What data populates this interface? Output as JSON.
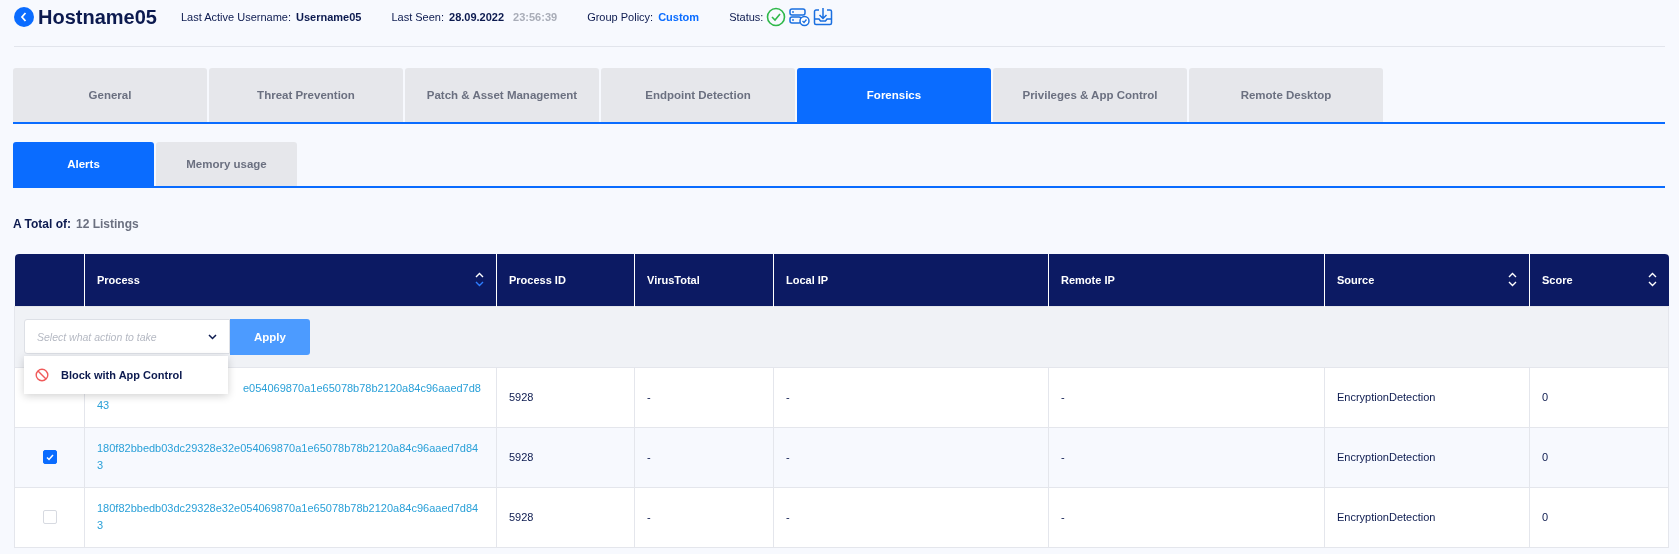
{
  "header": {
    "hostname": "Hostname05",
    "fields": [
      {
        "label": "Last Active Username:",
        "value": "Username05",
        "kind": "plain"
      },
      {
        "label": "Last Seen:",
        "value": "28.09.2022",
        "extra": "23:56:39",
        "kind": "plain"
      },
      {
        "label": "Group Policy:",
        "value": "Custom",
        "kind": "link"
      }
    ],
    "status_label": "Status:"
  },
  "tabs": [
    {
      "label": "General",
      "selected": false
    },
    {
      "label": "Threat Prevention",
      "selected": false
    },
    {
      "label": "Patch & Asset Management",
      "selected": false
    },
    {
      "label": "Endpoint Detection",
      "selected": false
    },
    {
      "label": "Forensics",
      "selected": true
    },
    {
      "label": "Privileges & App Control",
      "selected": false
    },
    {
      "label": "Remote Desktop",
      "selected": false
    }
  ],
  "subtabs": [
    {
      "label": "Alerts",
      "selected": true
    },
    {
      "label": "Memory usage",
      "selected": false
    }
  ],
  "total": {
    "label": "A Total of:",
    "value": "12 Listings"
  },
  "table": {
    "columns": [
      {
        "label": "Process",
        "sorted": true
      },
      {
        "label": "Process ID"
      },
      {
        "label": "VirusTotal"
      },
      {
        "label": "Local IP"
      },
      {
        "label": "Remote IP"
      },
      {
        "label": "Source",
        "sorted": false
      },
      {
        "label": "Score",
        "sorted": false
      }
    ],
    "action": {
      "placeholder": "Select what action to take",
      "apply": "Apply",
      "menu": [
        {
          "label": "Block with App Control"
        }
      ]
    },
    "rows": [
      {
        "process": "e054069870a1e65078b78b2120a84c96aaed7d843",
        "covered": true,
        "process_id": "5928",
        "virustotal": "-",
        "local_ip": "-",
        "remote_ip": "-",
        "source": "EncryptionDetection",
        "score": "0"
      },
      {
        "checked": true,
        "process": "180f82bbedb03dc29328e32e054069870a1e65078b78b2120a84c96aaed7d843",
        "process_id": "5928",
        "virustotal": "-",
        "local_ip": "-",
        "remote_ip": "-",
        "source": "EncryptionDetection",
        "score": "0"
      },
      {
        "checked": false,
        "process": "180f82bbedb03dc29328e32e054069870a1e65078b78b2120a84c96aaed7d843",
        "process_id": "5928",
        "virustotal": "-",
        "local_ip": "-",
        "remote_ip": "-",
        "source": "EncryptionDetection",
        "score": "0"
      }
    ]
  }
}
